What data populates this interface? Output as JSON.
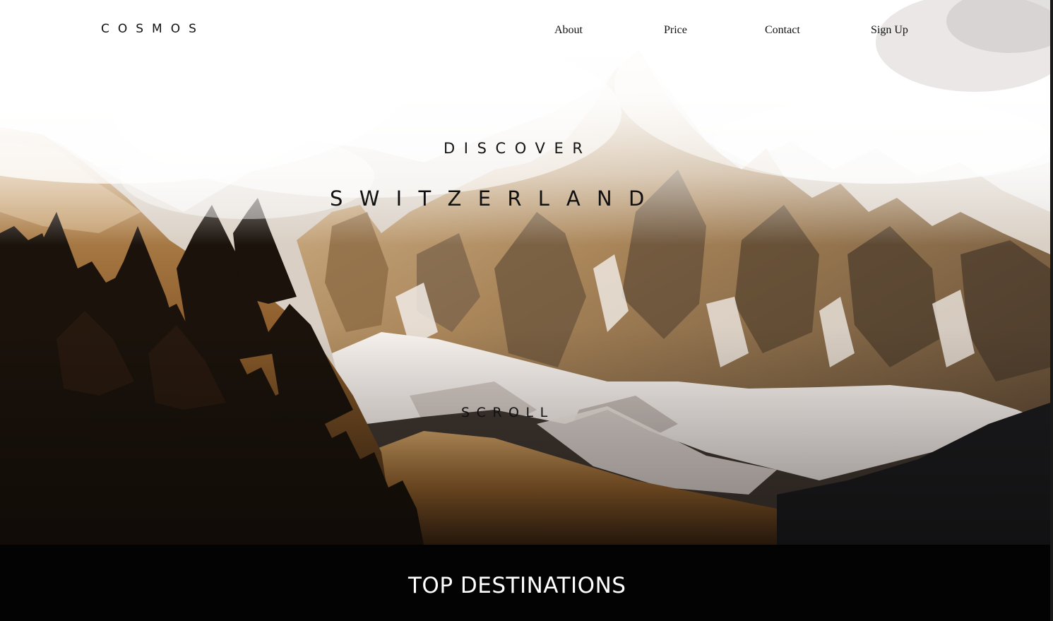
{
  "brand": {
    "name": "COSMOS"
  },
  "nav": {
    "items": [
      {
        "label": "About"
      },
      {
        "label": "Price"
      },
      {
        "label": "Contact"
      },
      {
        "label": "Sign Up"
      }
    ]
  },
  "hero": {
    "kicker": "DISCOVER",
    "headline": "SWITZERLAND",
    "scroll_label": "SCROLL"
  },
  "section": {
    "title": "TOP DESTINATIONS"
  },
  "colors": {
    "text_dark": "#111111",
    "section_bg": "#030303",
    "section_text": "#ffffff"
  }
}
